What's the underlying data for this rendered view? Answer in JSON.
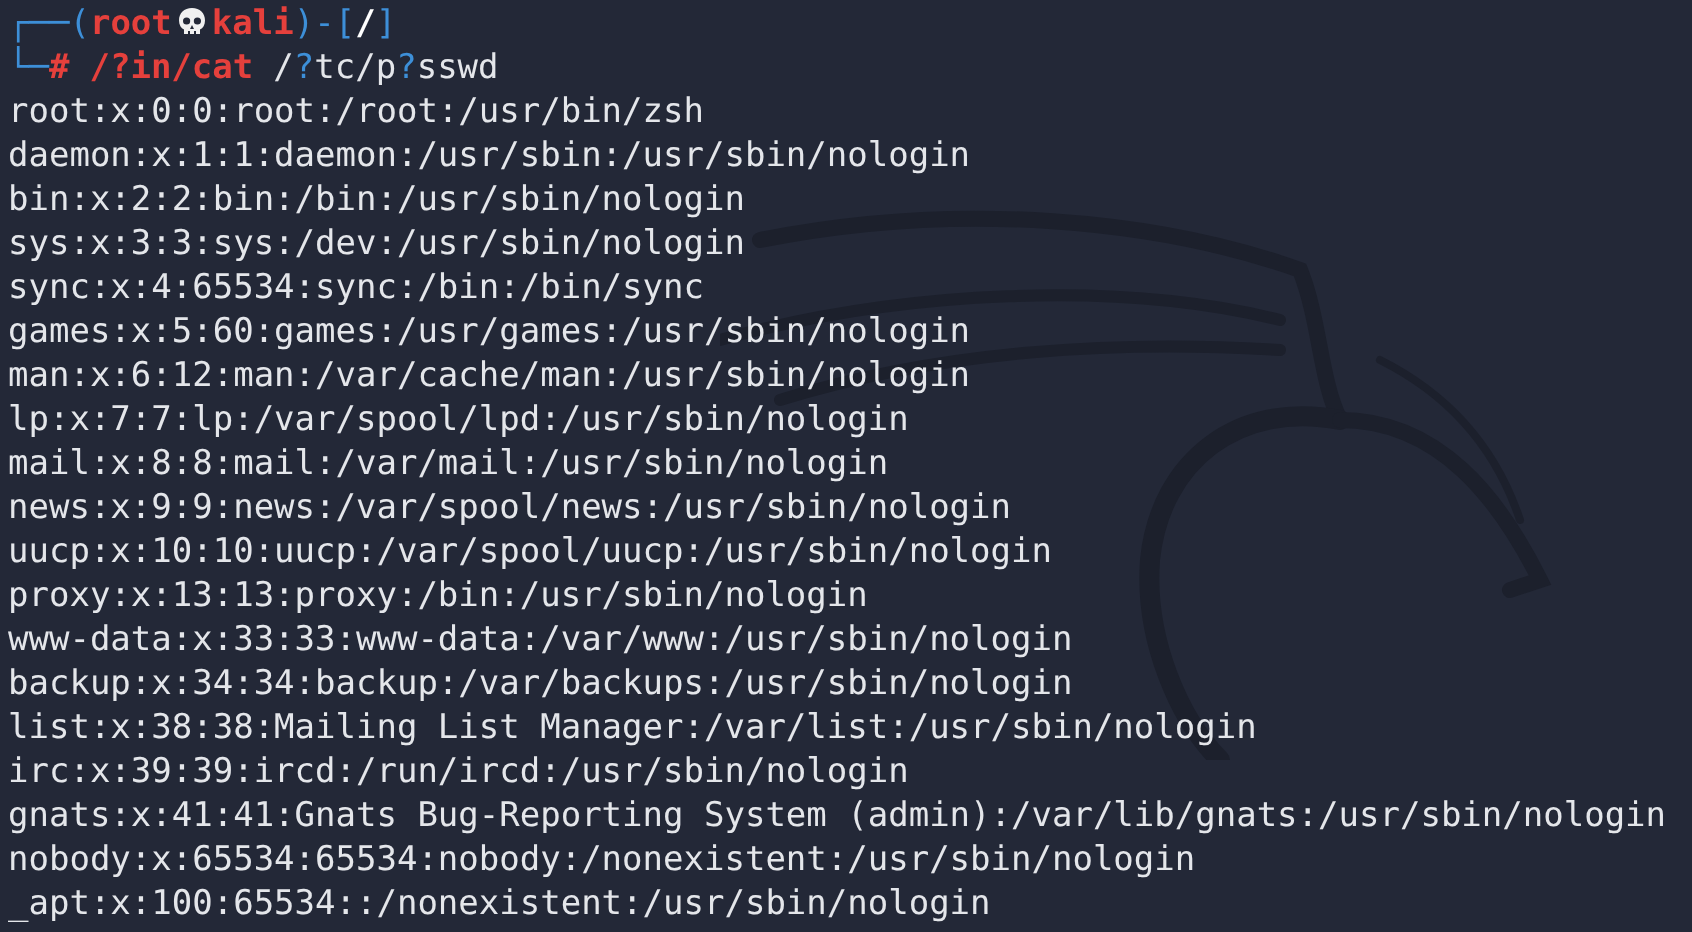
{
  "prompt": {
    "segments": [
      {
        "text": "┌──(",
        "kind": "frame"
      },
      {
        "text": "root",
        "kind": "user"
      },
      {
        "kind": "skull"
      },
      {
        "text": "kali",
        "kind": "host"
      },
      {
        "text": ")-[",
        "kind": "frame"
      },
      {
        "text": "/",
        "kind": "cwd"
      },
      {
        "text": "]",
        "kind": "frame"
      }
    ]
  },
  "command": {
    "segments": [
      {
        "text": "└─",
        "kind": "frame"
      },
      {
        "text": "#",
        "kind": "symbol"
      },
      {
        "text": "/?in/cat",
        "kind": "command"
      },
      {
        "text": "/",
        "kind": "arg"
      },
      {
        "text": "?",
        "kind": "glob"
      },
      {
        "text": "tc/p",
        "kind": "arg"
      },
      {
        "text": "?",
        "kind": "glob"
      },
      {
        "text": "sswd",
        "kind": "arg"
      }
    ]
  },
  "output": [
    "root:x:0:0:root:/root:/usr/bin/zsh",
    "daemon:x:1:1:daemon:/usr/sbin:/usr/sbin/nologin",
    "bin:x:2:2:bin:/bin:/usr/sbin/nologin",
    "sys:x:3:3:sys:/dev:/usr/sbin/nologin",
    "sync:x:4:65534:sync:/bin:/bin/sync",
    "games:x:5:60:games:/usr/games:/usr/sbin/nologin",
    "man:x:6:12:man:/var/cache/man:/usr/sbin/nologin",
    "lp:x:7:7:lp:/var/spool/lpd:/usr/sbin/nologin",
    "mail:x:8:8:mail:/var/mail:/usr/sbin/nologin",
    "news:x:9:9:news:/var/spool/news:/usr/sbin/nologin",
    "uucp:x:10:10:uucp:/var/spool/uucp:/usr/sbin/nologin",
    "proxy:x:13:13:proxy:/bin:/usr/sbin/nologin",
    "www-data:x:33:33:www-data:/var/www:/usr/sbin/nologin",
    "backup:x:34:34:backup:/var/backups:/usr/sbin/nologin",
    "list:x:38:38:Mailing List Manager:/var/list:/usr/sbin/nologin",
    "irc:x:39:39:ircd:/run/ircd:/usr/sbin/nologin",
    "gnats:x:41:41:Gnats Bug-Reporting System (admin):/var/lib/gnats:/usr/sbin/nologin",
    "nobody:x:65534:65534:nobody:/nonexistent:/usr/sbin/nologin",
    "_apt:x:100:65534::/nonexistent:/usr/sbin/nologin"
  ]
}
